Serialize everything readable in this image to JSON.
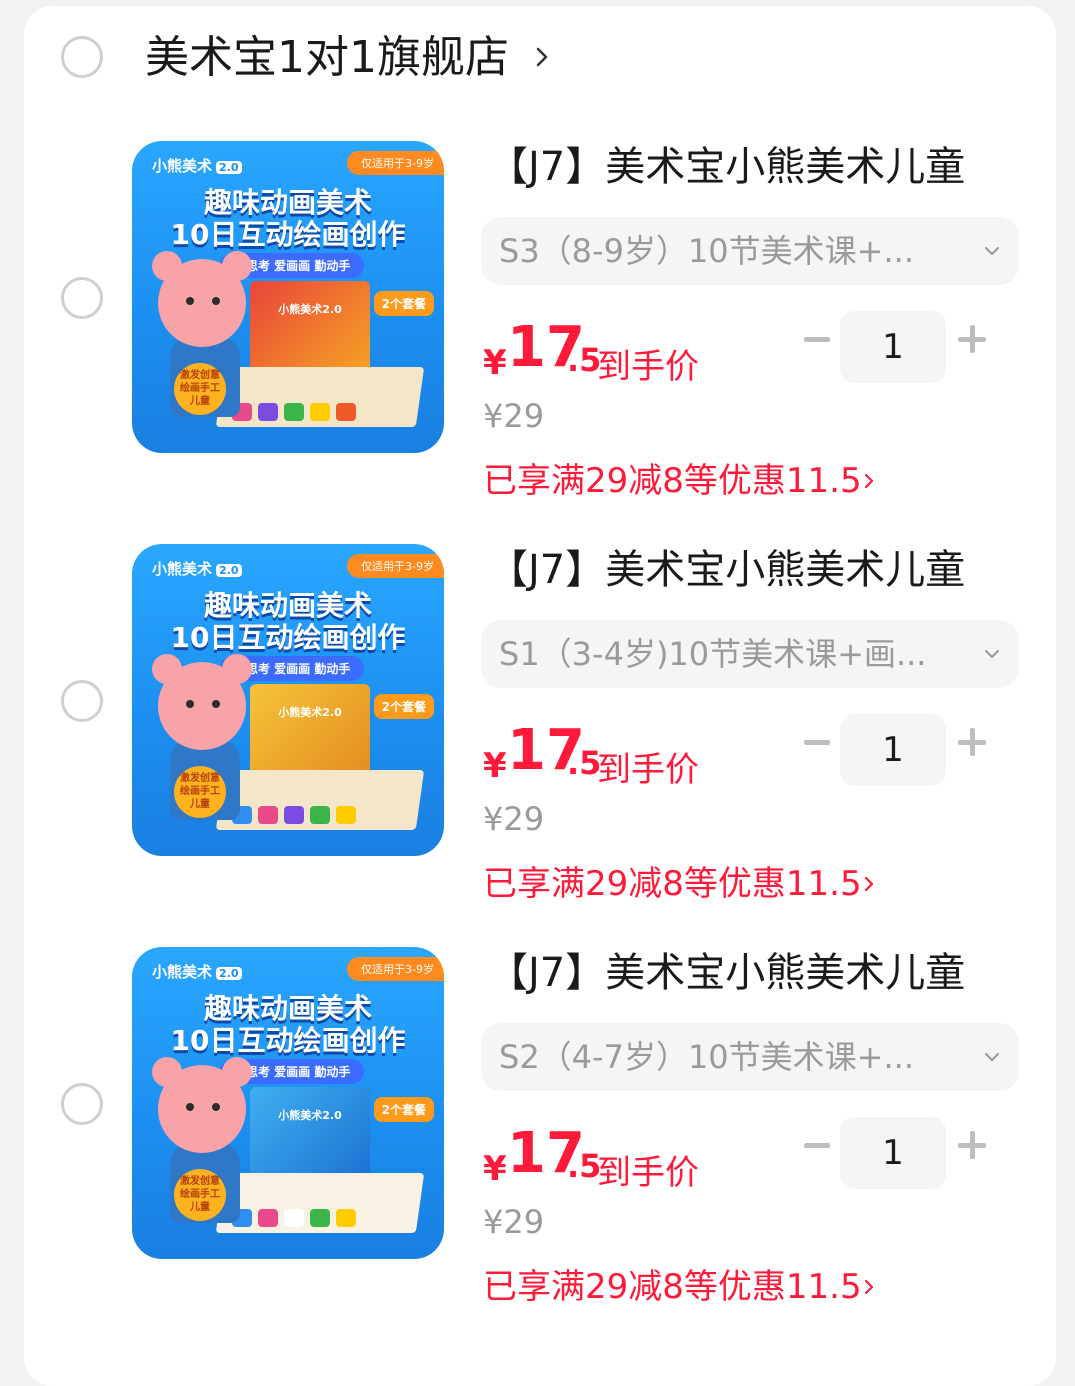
{
  "shop": {
    "name": "美术宝1对1旗舰店",
    "chevron_icon": "chevron-right-icon"
  },
  "items": [
    {
      "title": "【J7】美术宝小熊美术儿童",
      "sku": "S3（8-9岁）10节美术课+...",
      "price_symbol": "¥",
      "price_int": "17",
      "price_dec": ".5",
      "price_suffix": "到手价",
      "original_price": "¥29",
      "promo": "已享满29减8等优惠11.5",
      "quantity": "1",
      "thumb": {
        "brand": "小熊美术",
        "brand_badge": "2.0",
        "age_tag": "仅适用于3-9岁",
        "headline1": "趣味动画美术",
        "headline2": "10日互动绘画创作",
        "pill": "爱思考 爱画画 勤动手",
        "bonus": "2个套餐",
        "kit": "小熊美术2.0",
        "badge": "激发创意 绘画手工 儿童"
      }
    },
    {
      "title": "【J7】美术宝小熊美术儿童",
      "sku": "S1（3-4岁)10节美术课+画...",
      "price_symbol": "¥",
      "price_int": "17",
      "price_dec": ".5",
      "price_suffix": "到手价",
      "original_price": "¥29",
      "promo": "已享满29减8等优惠11.5",
      "quantity": "1",
      "thumb": {
        "brand": "小熊美术",
        "brand_badge": "2.0",
        "age_tag": "仅适用于3-9岁",
        "headline1": "趣味动画美术",
        "headline2": "10日互动绘画创作",
        "pill": "爱思考 爱画画 勤动手",
        "bonus": "2个套餐",
        "kit": "小熊美术2.0",
        "badge": "激发创意 绘画手工 儿童"
      }
    },
    {
      "title": "【J7】美术宝小熊美术儿童",
      "sku": "S2（4-7岁）10节美术课+...",
      "price_symbol": "¥",
      "price_int": "17",
      "price_dec": ".5",
      "price_suffix": "到手价",
      "original_price": "¥29",
      "promo": "已享满29减8等优惠11.5",
      "quantity": "1",
      "thumb": {
        "brand": "小熊美术",
        "brand_badge": "2.0",
        "age_tag": "仅适用于3-9岁",
        "headline1": "趣味动画美术",
        "headline2": "10日互动绘画创作",
        "pill": "爱思考 爱画画 勤动手",
        "bonus": "2个套餐",
        "kit": "小熊美术2.0",
        "badge": "激发创意 绘画手工 儿童"
      }
    }
  ],
  "colors": {
    "price_red": "#ff1a3a",
    "thumb_blue": "#1c8ff0",
    "muted_gray": "#9a9a9a",
    "field_bg": "#f5f5f5"
  }
}
